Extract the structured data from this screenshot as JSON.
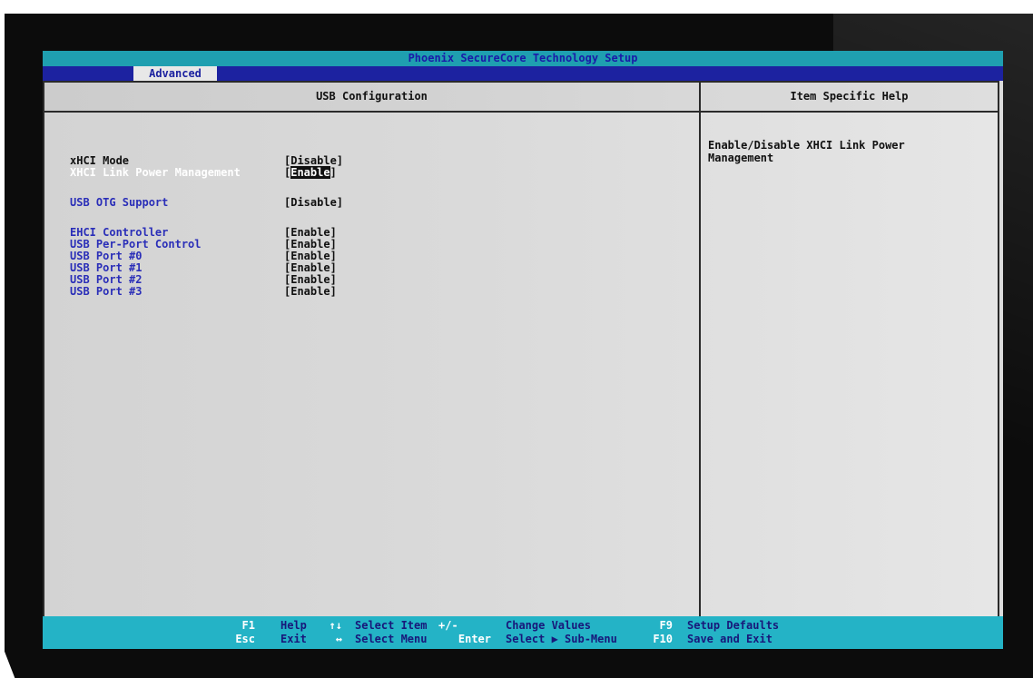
{
  "title": "Phoenix SecureCore Technology Setup",
  "menu": {
    "active_tab": "Advanced"
  },
  "main": {
    "header": "USB Configuration",
    "settings": [
      {
        "label": "xHCI Mode",
        "value": "[Disable]"
      },
      {
        "label": "XHCI Link Power Management",
        "value": "Enable"
      },
      {
        "label": "USB OTG Support",
        "value": "[Disable]"
      },
      {
        "label": "EHCI Controller",
        "value": "[Enable]"
      },
      {
        "label": "USB Per-Port Control",
        "value": "[Enable]"
      },
      {
        "label": "USB Port #0",
        "value": "[Enable]"
      },
      {
        "label": "USB Port #1",
        "value": "[Enable]"
      },
      {
        "label": "USB Port #2",
        "value": "[Enable]"
      },
      {
        "label": "USB Port #3",
        "value": "[Enable]"
      }
    ]
  },
  "help": {
    "header": "Item Specific Help",
    "text": "Enable/Disable XHCI Link Power Management"
  },
  "footer": {
    "keys": [
      {
        "key1": "F1",
        "desc1": "Help",
        "key2": "Esc",
        "desc2": "Exit"
      },
      {
        "key1": "↑↓",
        "desc1": "Select Item",
        "key2": "↔",
        "desc2": "Select Menu"
      },
      {
        "key1": "+/-",
        "desc1": "Change Values",
        "key2": "Enter",
        "desc2": "Select ▶ Sub-Menu"
      },
      {
        "key1": "F9",
        "desc1": "Setup Defaults",
        "key2": "F10",
        "desc2": "Save and Exit"
      }
    ]
  },
  "colors": {
    "titlebar": "#1f9fb0",
    "menubar": "#1c22a0",
    "footer": "#24b3c6",
    "item_blue": "#2a2eb8"
  }
}
